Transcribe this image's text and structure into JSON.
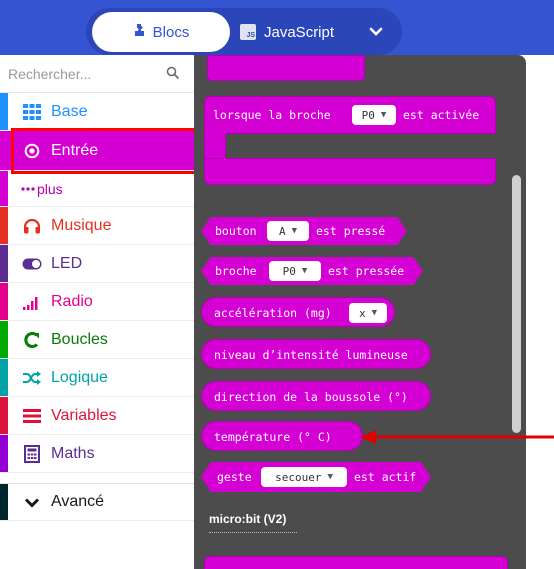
{
  "header": {
    "tabs": [
      {
        "label": "Blocs",
        "icon": "puzzle-piece-icon",
        "active": true
      },
      {
        "label": "JavaScript",
        "icon": "js-file-icon",
        "active": false
      }
    ],
    "js_badge": "JS",
    "more_icon": "chevron-down-icon",
    "colors": {
      "header": "#3454d1",
      "toggle": "#2a46b8"
    }
  },
  "sidebar": {
    "search_placeholder": "Rechercher...",
    "items": [
      {
        "label": "Base",
        "color": "#1e90ff",
        "icon": "grid-icon"
      },
      {
        "label": "Entrée",
        "color": "#d400d4",
        "icon": "target-icon",
        "selected": true
      },
      {
        "label": "plus",
        "color": "#d400d4",
        "icon": "dots-icon",
        "sub": true
      },
      {
        "label": "Musique",
        "color": "#e63022",
        "icon": "headphones-icon"
      },
      {
        "label": "LED",
        "color": "#5c2d91",
        "icon": "toggle-icon"
      },
      {
        "label": "Radio",
        "color": "#e3008c",
        "icon": "signal-bars-icon"
      },
      {
        "label": "Boucles",
        "color": "#00aa00",
        "icon": "refresh-icon"
      },
      {
        "label": "Logique",
        "color": "#00a4a6",
        "icon": "shuffle-icon"
      },
      {
        "label": "Variables",
        "color": "#dc143c",
        "icon": "list-icon"
      },
      {
        "label": "Maths",
        "color": "#9400d3",
        "icon": "calculator-icon"
      },
      {
        "label": "Avancé",
        "color": "#00272b",
        "icon": "chevron-down-icon"
      }
    ]
  },
  "flyout": {
    "color": "#d400d4",
    "blocks": {
      "pin_pressed": {
        "text_before": "lorsque la broche",
        "dropdown": "P0",
        "text_after": "est activée"
      },
      "button": {
        "text_before": "bouton",
        "dropdown": "A",
        "text_after": "est pressé"
      },
      "pin": {
        "text_before": "broche",
        "dropdown": "P0",
        "text_after": "est pressée"
      },
      "acceleration": {
        "text_before": "accélération (mg)",
        "dropdown": "x"
      },
      "light": {
        "text": "niveau d’intensité lumineuse"
      },
      "compass": {
        "text": "direction de la boussole (°)"
      },
      "temperature": {
        "text": "température (° C)"
      },
      "gesture": {
        "text_before": "geste",
        "dropdown": "secouer",
        "text_after": "est actif"
      }
    },
    "section_label": "micro:bit (V2)"
  },
  "annotation": {
    "arrow_color": "#e00000",
    "box_color": "#ff0000"
  }
}
